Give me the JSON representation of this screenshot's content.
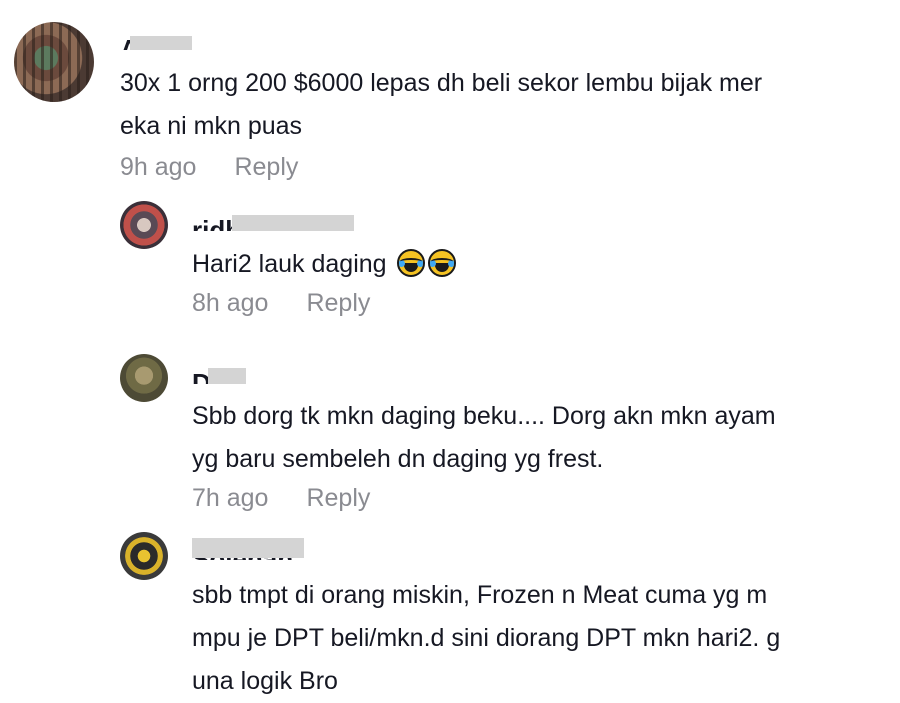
{
  "comments": [
    {
      "author": "A",
      "lines": [
        "30x 1 orng 200 $6000 lepas dh beli sekor lembu bijak mer",
        "eka ni mkn puas"
      ],
      "time": "9h ago",
      "reply": "Reply",
      "replies": [
        {
          "author": "ridhwanjohn",
          "lines": [
            "Hari2 lauk daging"
          ],
          "emoji": [
            "face-with-tears-of-joy",
            "face-with-tears-of-joy"
          ],
          "time": "8h ago",
          "reply": "Reply"
        },
        {
          "author": "D.K",
          "lines": [
            "Sbb dorg tk mkn daging beku.... Dorg akn mkn ayam",
            "yg baru sembeleh dn daging yg frest."
          ],
          "time": "7h ago",
          "reply": "Reply"
        },
        {
          "author": "Solehan",
          "lines": [
            "sbb tmpt di orang miskin, Frozen n Meat cuma yg m",
            "mpu je DPT beli/mkn.d sini diorang DPT mkn hari2. g",
            "una logik Bro"
          ]
        }
      ]
    }
  ]
}
